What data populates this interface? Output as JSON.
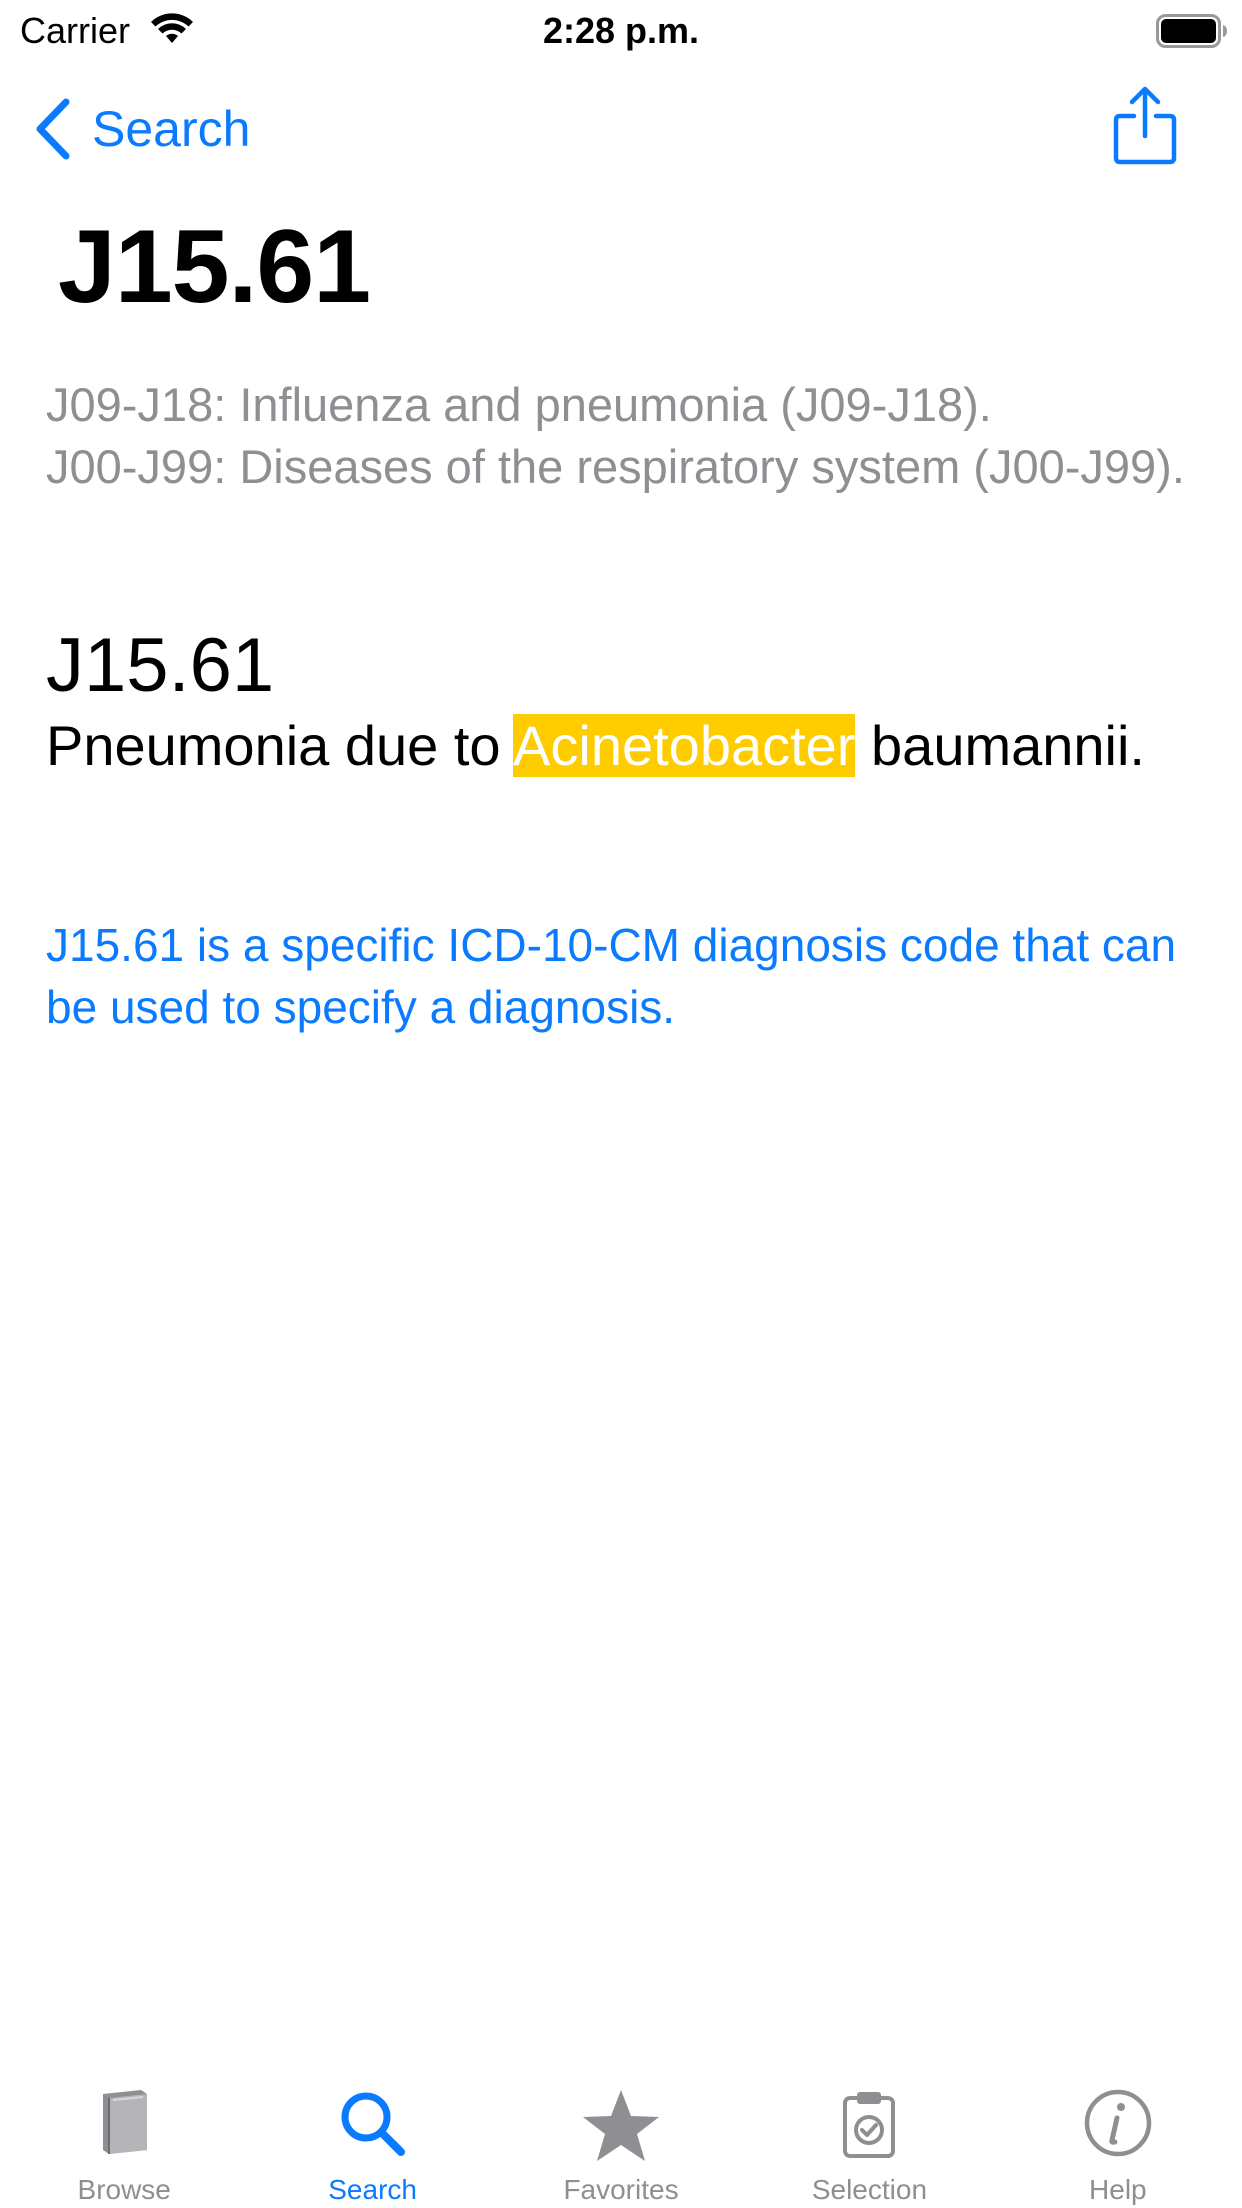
{
  "status_bar": {
    "carrier": "Carrier",
    "time": "2:28 p.m."
  },
  "nav": {
    "back_label": "Search",
    "share_icon": "share-icon"
  },
  "title": "J15.61",
  "hierarchy": [
    "J09-J18: Influenza and pneumonia (J09-J18).",
    "J00-J99: Diseases of the respiratory system (J00-J99)."
  ],
  "code": {
    "code": "J15.61",
    "desc_before": "Pneumonia due to ",
    "desc_highlight": "Acinetobacter",
    "desc_after": " baumannii."
  },
  "info_text": "J15.61 is a specific ICD-10-CM diagnosis code that can be used to specify a diagnosis.",
  "tabs": [
    {
      "label": "Browse",
      "icon": "book-icon",
      "active": false
    },
    {
      "label": "Search",
      "icon": "magnifier-icon",
      "active": true
    },
    {
      "label": "Favorites",
      "icon": "star-icon",
      "active": false
    },
    {
      "label": "Selection",
      "icon": "clipboard-check-icon",
      "active": false
    },
    {
      "label": "Help",
      "icon": "info-icon",
      "active": false
    }
  ],
  "colors": {
    "accent": "#0a7aff",
    "highlight": "#ffcc00",
    "secondary_text": "#8e8e93",
    "inactive_icon": "#8e8e93"
  }
}
